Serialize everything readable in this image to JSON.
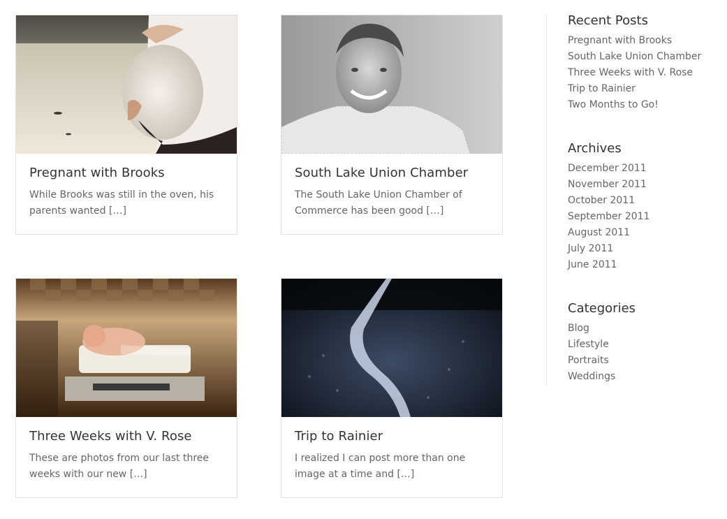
{
  "posts": [
    {
      "title": "Pregnant with Brooks",
      "excerpt": "While Brooks was still in the oven, his parents wanted […]",
      "image": "pregnant-belly-photo"
    },
    {
      "title": "South Lake Union Chamber",
      "excerpt": "The South Lake Union Chamber of Commerce has been good […]",
      "image": "portrait-man-bw-photo"
    },
    {
      "title": "Three Weeks with V. Rose",
      "excerpt": "These are photos from our last three weeks with our new […]",
      "image": "newborn-baby-photo"
    },
    {
      "title": "Trip to Rainier",
      "excerpt": "I realized I can post more than one image at a time and […]",
      "image": "rainier-river-photo"
    }
  ],
  "sidebar": {
    "recent_posts": {
      "title": "Recent Posts",
      "items": [
        "Pregnant with Brooks",
        "South Lake Union Chamber",
        "Three Weeks with V. Rose",
        "Trip to Rainier",
        "Two Months to Go!"
      ]
    },
    "archives": {
      "title": "Archives",
      "items": [
        "December 2011",
        "November 2011",
        "October 2011",
        "September 2011",
        "August 2011",
        "July 2011",
        "June 2011"
      ]
    },
    "categories": {
      "title": "Categories",
      "items": [
        "Blog",
        "Lifestyle",
        "Portraits",
        "Weddings"
      ]
    }
  }
}
